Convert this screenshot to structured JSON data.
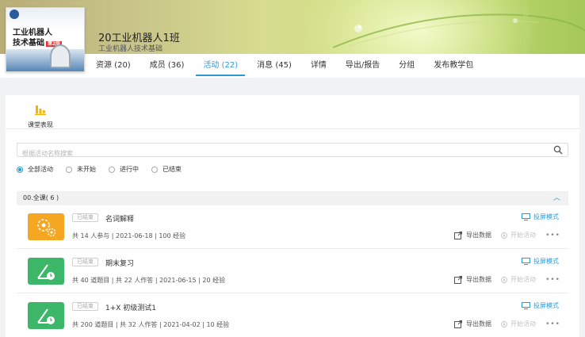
{
  "course": {
    "cover_title_line1": "工业机器人",
    "cover_title_line2": "技术基础",
    "cover_edition": "第2版",
    "class_name": "20工业机器人1班",
    "subtitle": "工业机器人技术基础"
  },
  "tabs": [
    {
      "label": "资源 (20)"
    },
    {
      "label": "成员 (36)"
    },
    {
      "label": "活动 (22)"
    },
    {
      "label": "消息 (45)"
    },
    {
      "label": "详情"
    },
    {
      "label": "导出/报告"
    },
    {
      "label": "分组"
    },
    {
      "label": "发布教学包"
    }
  ],
  "active_tab": "活动 (22)",
  "toolbar": {
    "class_performance_label": "课堂表现"
  },
  "search": {
    "placeholder": "根据活动名称搜索"
  },
  "filters": [
    {
      "label": "全部活动",
      "selected": true
    },
    {
      "label": "未开始",
      "selected": false
    },
    {
      "label": "进行中",
      "selected": false
    },
    {
      "label": "已结束",
      "selected": false
    }
  ],
  "group": {
    "title": "00.全课( 6 )",
    "collapse_icon": "chevron-up-icon"
  },
  "activities": [
    {
      "status": "已结束",
      "name": "名词解释",
      "meta": "共 14 人参与  |  2021-06-18  |  100 经验",
      "icon": "brainstorm-icon",
      "icon_color": "#f5a623",
      "project_label": "投屏模式",
      "export_label": "导出数据",
      "start_label": "开始活动"
    },
    {
      "status": "已结束",
      "name": "期末复习",
      "meta": "共 40 道题目  |  共 22 人作答  |  2021-06-15  |  20 经验",
      "icon": "test-icon",
      "icon_color": "#3cb769",
      "project_label": "投屏模式",
      "export_label": "导出数据",
      "start_label": "开始活动"
    },
    {
      "status": "已结束",
      "name": "1+X 初级测试1",
      "meta": "共 200 道题目  |  共 32 人作答  |  2021-04-02  |  10 经验",
      "icon": "test-icon",
      "icon_color": "#3cb769",
      "project_label": "投屏模式",
      "export_label": "导出数据",
      "start_label": "开始活动"
    }
  ],
  "colors": {
    "accent": "#2d9ad5",
    "orange": "#f5a623",
    "green": "#3cb769"
  }
}
